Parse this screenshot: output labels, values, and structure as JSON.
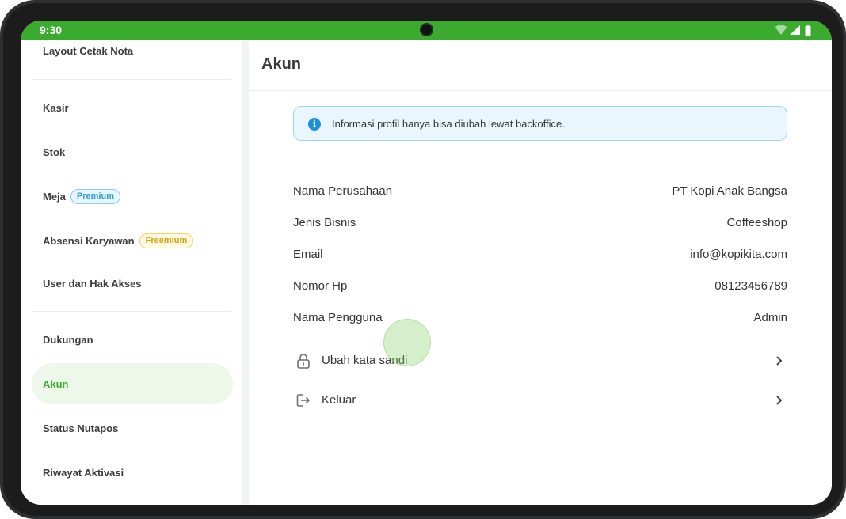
{
  "status_bar": {
    "time": "9:30",
    "icons": [
      "wifi-icon",
      "signal-icon",
      "battery-icon"
    ]
  },
  "sidebar": {
    "items": [
      {
        "label": "Layout Cetak Nota"
      },
      {
        "label": "Kasir"
      },
      {
        "label": "Stok"
      },
      {
        "label": "Meja",
        "badge": "Premium"
      },
      {
        "label": "Absensi Karyawan",
        "badge": "Freemium"
      },
      {
        "label": "User dan Hak Akses"
      },
      {
        "label": "Dukungan"
      },
      {
        "label": "Akun",
        "active": true
      },
      {
        "label": "Status Nutapos"
      },
      {
        "label": "Riwayat Aktivasi"
      }
    ]
  },
  "main": {
    "title": "Akun",
    "info_banner": {
      "icon": "info-icon",
      "text": "Informasi profil hanya bisa diubah lewat backoffice."
    },
    "profile": [
      {
        "label": "Nama Perusahaan",
        "value": "PT Kopi Anak Bangsa"
      },
      {
        "label": "Jenis Bisnis",
        "value": "Coffeeshop"
      },
      {
        "label": "Email",
        "value": "info@kopikita.com"
      },
      {
        "label": "Nomor Hp",
        "value": "08123456789"
      },
      {
        "label": "Nama Pengguna",
        "value": "Admin"
      }
    ],
    "actions": [
      {
        "label": "Ubah kata sandi",
        "icon": "lock-icon"
      },
      {
        "label": "Keluar",
        "icon": "logout-icon"
      }
    ]
  },
  "colors": {
    "brand_green": "#3aab2f",
    "active_item_bg": "#edf8eb",
    "info_bg": "#e9f6fd",
    "info_icon": "#1e8fdd",
    "premium_badge": "#2b9fd6",
    "freemium_badge": "#d3a10a"
  }
}
